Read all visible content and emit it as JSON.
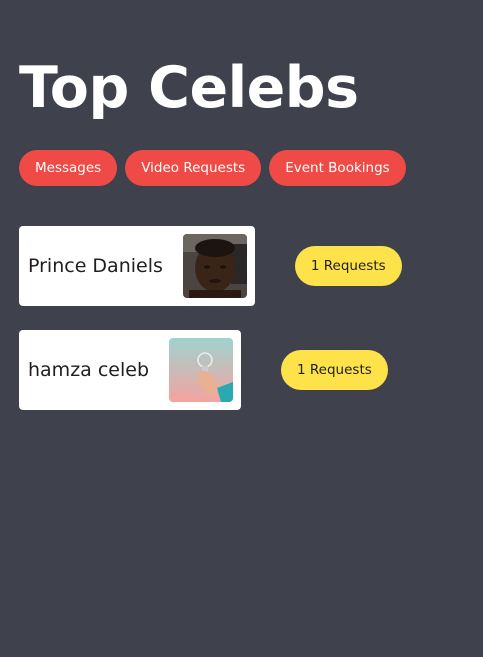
{
  "header": {
    "title": "Top Celebs"
  },
  "nav": {
    "tabs": [
      {
        "label": "Messages"
      },
      {
        "label": "Video Requests"
      },
      {
        "label": "Event Bookings"
      }
    ]
  },
  "celebs": [
    {
      "name": "Prince Daniels",
      "requests_label": "1 Requests",
      "avatar": "person-photo"
    },
    {
      "name": "hamza celeb",
      "requests_label": "1 Requests",
      "avatar": "lightbulb-photo"
    }
  ],
  "colors": {
    "background": "#3f424c",
    "nav_pill": "#f04a46",
    "request_badge": "#fde24a",
    "card": "#ffffff"
  }
}
